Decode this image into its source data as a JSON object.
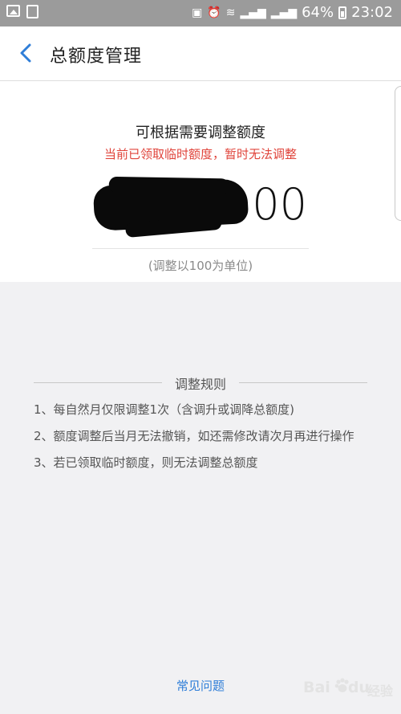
{
  "status_bar": {
    "battery_percent": "64%",
    "time": "23:02"
  },
  "header": {
    "title": "总额度管理"
  },
  "card": {
    "title": "可根据需要调整额度",
    "warning": "当前已领取临时额度，暂时无法调整",
    "amount_visible_suffix": "00",
    "unit_note": "(调整以100为单位)"
  },
  "rules": {
    "title": "调整规则",
    "items": [
      "1、每自然月仅限调整1次（含调升或调降总额度)",
      "2、额度调整后当月无法撤销，如还需修改请次月再进行操作",
      "3、若已领取临时额度，则无法调整总额度"
    ]
  },
  "footer": {
    "faq_label": "常见问题"
  },
  "watermark": {
    "brand_text": "Bai",
    "brand_text_2": "du",
    "cn_text": "经验"
  },
  "colors": {
    "warning": "#e0443b",
    "link": "#2f7ed8",
    "back_arrow": "#2f7ed8"
  }
}
